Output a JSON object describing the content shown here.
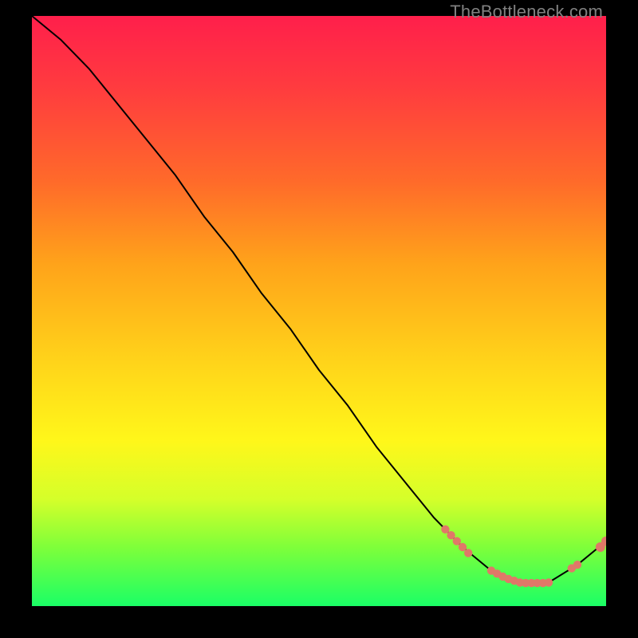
{
  "watermark": "TheBottleneck.com",
  "chart_data": {
    "type": "line",
    "title": "",
    "xlabel": "",
    "ylabel": "",
    "xlim": [
      0,
      100
    ],
    "ylim": [
      0,
      100
    ],
    "series": [
      {
        "name": "bottleneck-curve",
        "x": [
          0,
          5,
          10,
          15,
          20,
          25,
          30,
          35,
          40,
          45,
          50,
          55,
          60,
          65,
          70,
          72,
          75,
          80,
          85,
          90,
          95,
          100
        ],
        "values": [
          100,
          96,
          91,
          85,
          79,
          73,
          66,
          60,
          53,
          47,
          40,
          34,
          27,
          21,
          15,
          13,
          10,
          6,
          4,
          4,
          7,
          11
        ]
      }
    ],
    "points": [
      {
        "name": "cluster-left",
        "x": 72,
        "y": 13
      },
      {
        "name": "cluster-left",
        "x": 73,
        "y": 12
      },
      {
        "name": "cluster-left",
        "x": 74,
        "y": 11
      },
      {
        "name": "cluster-left",
        "x": 75,
        "y": 10
      },
      {
        "name": "cluster-left",
        "x": 76,
        "y": 9
      },
      {
        "name": "valley-floor",
        "x": 80,
        "y": 6
      },
      {
        "name": "valley-floor",
        "x": 81,
        "y": 5.5
      },
      {
        "name": "valley-floor",
        "x": 82,
        "y": 5
      },
      {
        "name": "valley-floor",
        "x": 83,
        "y": 4.6
      },
      {
        "name": "valley-floor",
        "x": 84,
        "y": 4.3
      },
      {
        "name": "valley-floor",
        "x": 85,
        "y": 4
      },
      {
        "name": "valley-floor",
        "x": 86,
        "y": 3.9
      },
      {
        "name": "valley-floor",
        "x": 87,
        "y": 3.9
      },
      {
        "name": "valley-floor",
        "x": 88,
        "y": 3.9
      },
      {
        "name": "valley-floor",
        "x": 89,
        "y": 3.9
      },
      {
        "name": "valley-floor",
        "x": 90,
        "y": 4
      },
      {
        "name": "cluster-right",
        "x": 94,
        "y": 6.4
      },
      {
        "name": "cluster-right",
        "x": 95,
        "y": 7
      },
      {
        "name": "end",
        "x": 99,
        "y": 10
      },
      {
        "name": "end",
        "x": 100,
        "y": 11
      }
    ],
    "point_color": "#e07868",
    "line_color": "#000000"
  }
}
